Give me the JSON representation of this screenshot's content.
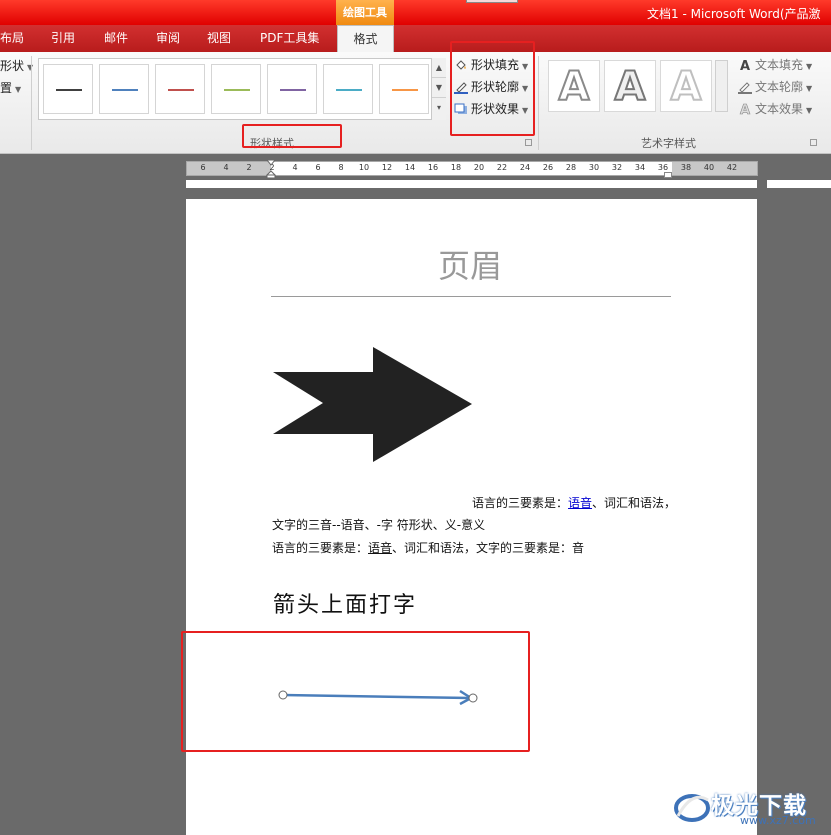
{
  "titlebar": {
    "context_tab": "绘图工具",
    "window_title": "文档1 - Microsoft Word(产品激"
  },
  "tabs": [
    {
      "label": "布局"
    },
    {
      "label": "引用"
    },
    {
      "label": "邮件"
    },
    {
      "label": "审阅"
    },
    {
      "label": "视图"
    },
    {
      "label": "PDF工具集"
    },
    {
      "label": "格式",
      "active": true
    }
  ],
  "ribbon": {
    "left_cut": {
      "item1": "形状",
      "item2": "置"
    },
    "shape_styles": {
      "group_label": "形状样式",
      "swatches": [
        {
          "color": "#404040"
        },
        {
          "color": "#4f81bd"
        },
        {
          "color": "#c0504d"
        },
        {
          "color": "#9bbb59"
        },
        {
          "color": "#8064a2"
        },
        {
          "color": "#4bacc6"
        },
        {
          "color": "#f79646"
        }
      ]
    },
    "shape_commands": {
      "fill": {
        "label": "形状填充",
        "icon": "paint-bucket-icon"
      },
      "outline": {
        "label": "形状轮廓",
        "icon": "pen-outline-icon"
      },
      "effects": {
        "label": "形状效果",
        "icon": "shape-effects-icon"
      }
    },
    "wordart": {
      "group_label": "艺术字样式",
      "sample_glyph": "A",
      "text_fill": "文本填充",
      "text_outline": "文本轮廓",
      "text_effects": "文本效果"
    }
  },
  "ruler": {
    "ticks": [
      "6",
      "4",
      "2",
      "2",
      "4",
      "6",
      "8",
      "10",
      "12",
      "14",
      "16",
      "18",
      "20",
      "22",
      "24",
      "26",
      "28",
      "30",
      "32",
      "34",
      "36",
      "38",
      "40",
      "42"
    ]
  },
  "document": {
    "header_title": "页眉",
    "line1_prefix": "语言的三要素是：",
    "line1_link": "语音",
    "line1_suffix": "、词汇和语法，",
    "line2": "文字的三音--语音、-字 符形状、义-意义",
    "line3_prefix": "语言的三要素是：",
    "line3_underlined": "语音",
    "line3_suffix": "、词汇和语法，文字的三要素是：音",
    "heading": "箭头上面打字"
  },
  "watermark": {
    "brand": "极光下载",
    "url": "www.xz7.com"
  },
  "colors": {
    "highlight": "#e62020",
    "connector": "#4a7ebb",
    "arrow_shape": "#222222"
  }
}
